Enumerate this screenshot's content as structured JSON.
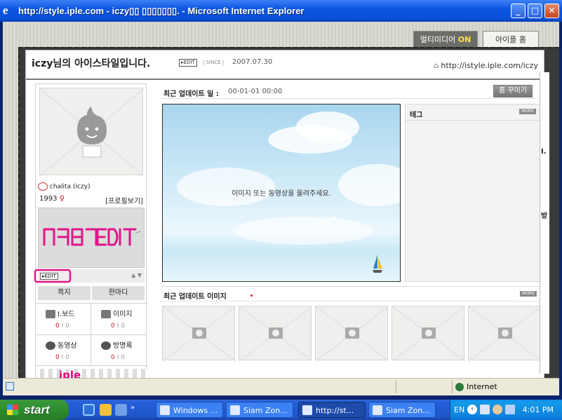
{
  "window": {
    "title": "http://style.iple.com - iczyвЁи вЁивЁивЁи. - Microsoft Internet Explorer",
    "title_display": "http://style.iple.com - iczy▯▯ ▯▯▯▯▯▯▯. - Microsoft Internet Explorer",
    "btn_min": "_",
    "btn_max": "□",
    "btn_close": "✕"
  },
  "top_buttons": {
    "multimedia_label": "멀티미디어",
    "multimedia_state": "ON",
    "home_label": "아이플 홈"
  },
  "header": {
    "title": "iczy님의 아이스타일입니다.",
    "edit": "▸EDIT",
    "since": "| SINCE |",
    "since_date": "2007.07.30",
    "url": "http://istyle.iple.com/iczy"
  },
  "profile": {
    "name": "chalita (iczy)",
    "year": "1993",
    "sex_symbol": "♀",
    "profile_view": "[프로필보기]",
    "edit": "▸EDIT",
    "msg_btn": "쪽지",
    "comment_btn": "한마디",
    "handwritten": "€€ EDIT"
  },
  "menu": [
    {
      "name": "I.보드",
      "new": "0",
      "total": "0"
    },
    {
      "name": "이미지",
      "new": "0",
      "total": "0"
    },
    {
      "name": "동영상",
      "new": "0",
      "total": "0"
    },
    {
      "name": "방명록",
      "new": "0",
      "total": "0"
    }
  ],
  "sep": "I",
  "banner": "iple",
  "main": {
    "update_label": "최근 업데이트 일 :",
    "update_date": "00-01-01 00:00",
    "decorate_btn": "홈 꾸미기",
    "sky_text": "이미지 또는 동영상을 올려주세요.",
    "tag_title": "테그",
    "more": "MORE",
    "recent_images": "최근 업데이트 이미지"
  },
  "sidebar_partial": [
    "I.",
    "방"
  ],
  "status": {
    "zone": "Internet"
  },
  "taskbar": {
    "start": "start",
    "buttons": [
      "Windows ...",
      "Siam Zon...",
      "http://st...",
      "Siam Zon..."
    ],
    "lang": "EN",
    "clock": "4:01 PM"
  }
}
